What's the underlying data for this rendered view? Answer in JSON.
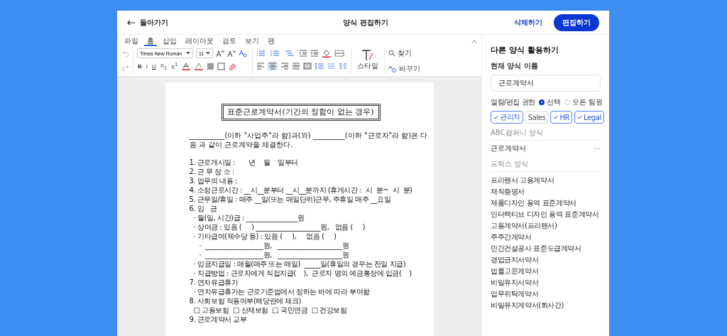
{
  "header": {
    "back": "돌아가기",
    "title": "양식 편집하기",
    "delete": "삭제하기",
    "edit": "편집하기"
  },
  "menu_tabs": [
    {
      "label": "파일",
      "selected": false
    },
    {
      "label": "홈",
      "selected": true
    },
    {
      "label": "삽입",
      "selected": false
    },
    {
      "label": "레이아웃",
      "selected": false
    },
    {
      "label": "검토",
      "selected": false
    },
    {
      "label": "보기",
      "selected": false
    },
    {
      "label": "펜",
      "selected": false
    }
  ],
  "toolbar": {
    "font": "Times New Roman",
    "size": "11",
    "format_buttons": [
      "B",
      "I",
      "U",
      "X$_{1}$",
      "X$^{1}$"
    ],
    "style": "스타일",
    "find": "찾기",
    "replace": "바꾸기"
  },
  "document": {
    "title": "표준근로계약서(기간의 정함이 없는 경우)",
    "intro": "__________(이하 \"사업주\"라 함)과(와) _________(이하 \"근로자\"라 함)은 다음 과 같이 근로계약을 체결한다.",
    "lines": [
      {
        "kind": "item",
        "text": "1. 근로개시일 :       년    월    일부터"
      },
      {
        "kind": "item",
        "text": "2. 근 무 장 소 :"
      },
      {
        "kind": "item",
        "text": "3. 업무의 내용 :"
      },
      {
        "kind": "item",
        "text": "4. 소정근로시간 : __시__분부터 __시__분까지 (휴게시간 :  시  분~  시  분)"
      },
      {
        "kind": "item",
        "text": "5. 근무일/휴일 : 매주 __일(또는 매일단위)근무, 주휴일 매주 __요일"
      },
      {
        "kind": "item",
        "text": "6. 임   금"
      },
      {
        "kind": "sub",
        "text": "· 월(일, 시간)급 : ________________원"
      },
      {
        "kind": "sub",
        "text": "· 상여금 : 있음 (     ) ____________________원,   없음 (     )"
      },
      {
        "kind": "sub",
        "text": "· 기타급여(제수당 등) : 있음 (     ),     없음 (     )"
      },
      {
        "kind": "subsub",
        "text": "·  __________________원,   ____________________원"
      },
      {
        "kind": "subsub",
        "text": "·  __________________원,   ____________________원"
      },
      {
        "kind": "sub",
        "text": "· 임금지급일 : 매월(매주 또는 매일)  _____일(휴일의 경우는 전일 지급)"
      },
      {
        "kind": "sub",
        "text": "· 지급방법 : 근로자에게 직접지급(    ),  근로자 명의 예금통장에 입금(    )"
      },
      {
        "kind": "item",
        "text": "7. 연차유급휴가"
      },
      {
        "kind": "sub",
        "text": "· 연차유급휴가는 근로기준법에서 정하는 바에 따라 부여함"
      },
      {
        "kind": "item",
        "text": "8. 사회보험 적용여부(해당란에 체크)"
      },
      {
        "kind": "sub",
        "text": "□ 고용보험  □ 산재보험  □ 국민연금  □ 건강보험"
      },
      {
        "kind": "item",
        "text": "9. 근로계약서 교부"
      }
    ]
  },
  "sidebar": {
    "title": "다른 양식 활용하기",
    "name_label": "현재 양식 이름",
    "name_value": "근로계약서",
    "permission_label": "열람/편집 권한",
    "radios": [
      {
        "label": "선택",
        "selected": true
      },
      {
        "label": "모든 팀원",
        "selected": false
      }
    ],
    "chips": [
      {
        "label": "관리자",
        "checked": true
      },
      {
        "label": "Sales",
        "checked": false
      },
      {
        "label": "HR",
        "checked": true
      },
      {
        "label": "Legal",
        "checked": true
      }
    ],
    "company_section": "ABC컴퍼니 양식",
    "company_items": [
      "근로계약서"
    ],
    "prix_section": "프릭스 양식",
    "prix_items": [
      "프리랜서 고용계약서",
      "재직증명서",
      "제품디자인 용역 표준계약서",
      "인터랙티브 디자인 용역 표준계약서",
      "고용계약서(프리랜서)",
      "주주간계약서",
      "민간건설공사 표준도급계약서",
      "경업금지서약서",
      "법률고문계약서",
      "비밀유지서약서",
      "업무위탁계약서",
      "비밀유지계약서(회사간)"
    ]
  }
}
